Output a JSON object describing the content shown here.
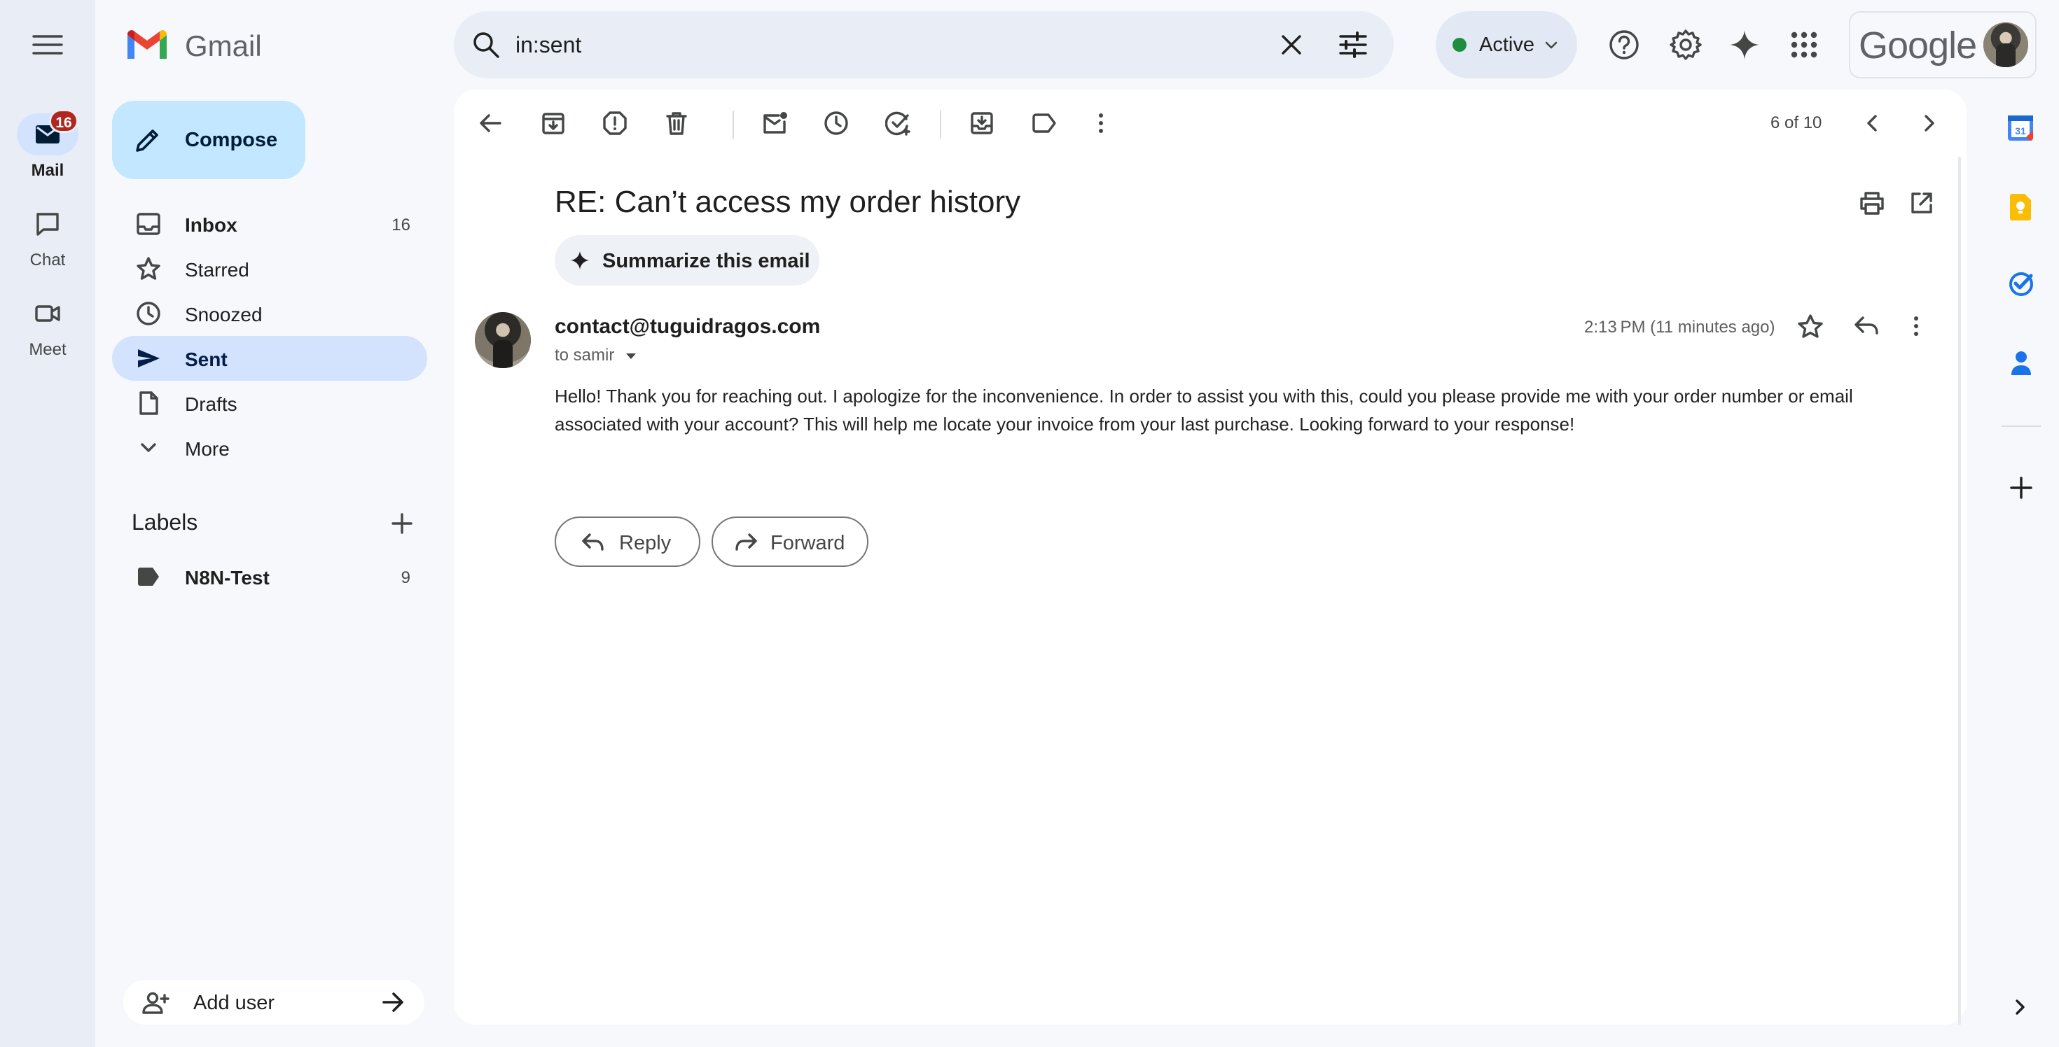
{
  "app": {
    "name": "Gmail",
    "google_wordmark": "Google"
  },
  "rail": {
    "mail_label": "Mail",
    "mail_badge": "16",
    "chat_label": "Chat",
    "meet_label": "Meet"
  },
  "search": {
    "value": "in:sent"
  },
  "status": {
    "label": "Active",
    "color": "#1e8e3e"
  },
  "sidebar": {
    "compose_label": "Compose",
    "items": [
      {
        "label": "Inbox",
        "count": "16",
        "icon": "inbox-icon"
      },
      {
        "label": "Starred",
        "count": "",
        "icon": "star-icon"
      },
      {
        "label": "Snoozed",
        "count": "",
        "icon": "clock-icon"
      },
      {
        "label": "Sent",
        "count": "",
        "icon": "send-icon",
        "selected": true
      },
      {
        "label": "Drafts",
        "count": "",
        "icon": "draft-icon"
      },
      {
        "label": "More",
        "count": "",
        "icon": "chevron-down-icon"
      }
    ],
    "labels_heading": "Labels",
    "labels": [
      {
        "label": "N8N-Test",
        "count": "9"
      }
    ],
    "add_user_label": "Add user"
  },
  "toolbar": {
    "pagination": "6 of 10"
  },
  "email": {
    "subject": "RE: Can’t access my order history",
    "summarize_label": "Summarize this email",
    "sender": "contact@tuguidragos.com",
    "to": "to samir",
    "time": "2:13 PM (11 minutes ago)",
    "body_lines": [
      "Hello! Thank you for reaching out. I apologize for the inconvenience. In order to assist you with this, could you please provide me with your order number or email",
      "associated with your account? This will help me locate your invoice from your last purchase. Looking forward to your response!"
    ],
    "reply_label": "Reply",
    "forward_label": "Forward"
  },
  "colors": {
    "accent": "#0b57d0",
    "compose_bg": "#c2e7ff",
    "selected_nav": "#d3e3fd",
    "badge": "#b3261e"
  }
}
